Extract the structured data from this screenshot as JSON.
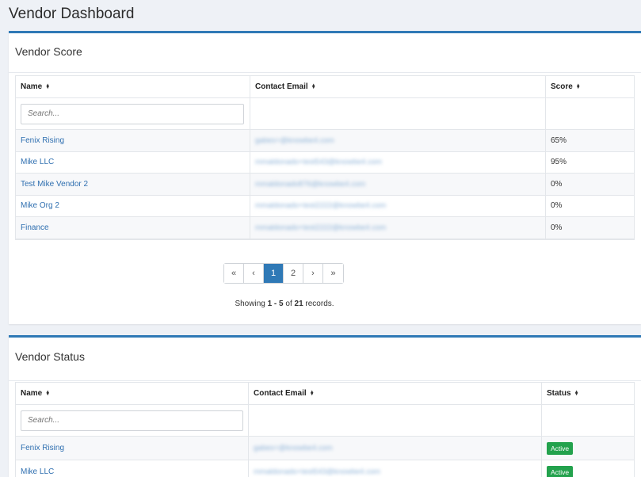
{
  "page": {
    "title": "Vendor Dashboard"
  },
  "vendor_score": {
    "title": "Vendor Score",
    "columns": [
      "Name",
      "Contact Email",
      "Score"
    ],
    "search_placeholder": "Search...",
    "rows": [
      {
        "name": "Fenix Rising",
        "email": "gabes+@knowbe4.com",
        "score": "65%"
      },
      {
        "name": "Mike LLC",
        "email": "mmaldonado+test543@knowbe4.com",
        "score": "95%"
      },
      {
        "name": "Test Mike Vendor 2",
        "email": "mmaldonado876@knowbe4.com",
        "score": "0%"
      },
      {
        "name": "Mike Org 2",
        "email": "mmaldonado+test2222@knowbe4.com",
        "score": "0%"
      },
      {
        "name": "Finance",
        "email": "mmaldonado+test2222@knowbe4.com",
        "score": "0%"
      }
    ],
    "pagination": {
      "first": "«",
      "prev": "‹",
      "pages": [
        "1",
        "2"
      ],
      "next": "›",
      "last": "»",
      "current": "1"
    },
    "records": {
      "prefix": "Showing ",
      "range": "1 - 5",
      "of": " of ",
      "total": "21",
      "suffix": " records."
    }
  },
  "vendor_status": {
    "title": "Vendor Status",
    "columns": [
      "Name",
      "Contact Email",
      "Status"
    ],
    "search_placeholder": "Search...",
    "rows": [
      {
        "name": "Fenix Rising",
        "email": "gabes+@knowbe4.com",
        "status": "Active"
      },
      {
        "name": "Mike LLC",
        "email": "mmaldonado+test543@knowbe4.com",
        "status": "Active"
      }
    ]
  }
}
